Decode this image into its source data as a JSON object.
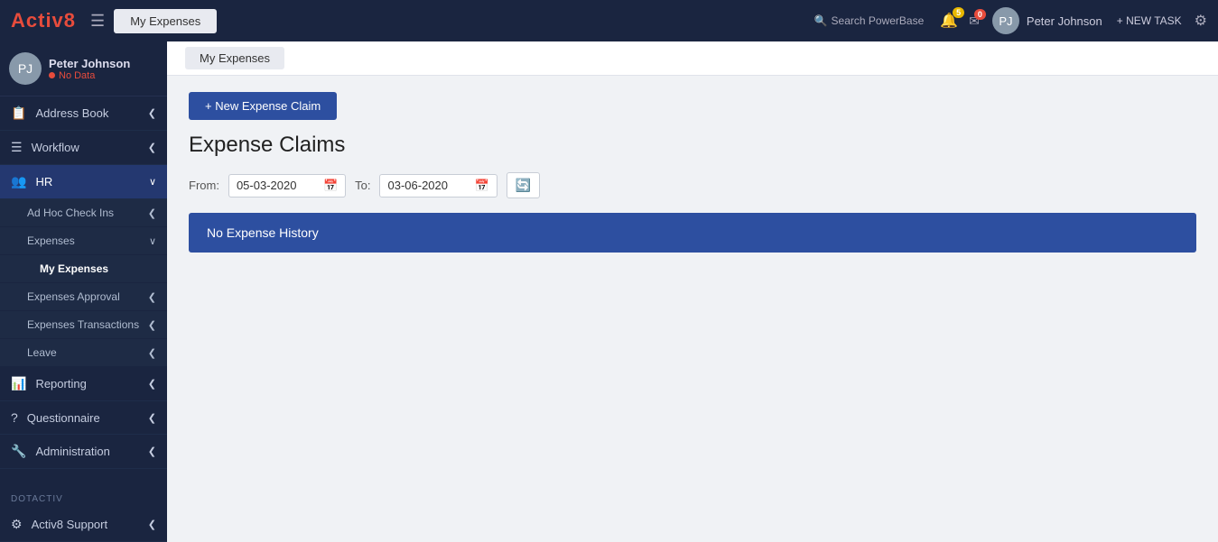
{
  "app": {
    "logo_text": "Activ",
    "logo_accent": "8"
  },
  "topnav": {
    "hamburger_icon": "☰",
    "tab_label": "My Expenses",
    "search_label": "Search PowerBase",
    "notifications_count": "5",
    "messages_count": "0",
    "username": "Peter Johnson",
    "new_task_label": "+ NEW TASK",
    "gear_icon": "⚙"
  },
  "sidebar": {
    "user": {
      "name": "Peter Johnson",
      "status": "No Data"
    },
    "items": [
      {
        "id": "address-book",
        "icon": "📋",
        "label": "Address Book",
        "has_chevron": true
      },
      {
        "id": "workflow",
        "icon": "≡",
        "label": "Workflow",
        "has_chevron": true
      },
      {
        "id": "hr",
        "icon": "👥",
        "label": "HR",
        "has_chevron": true,
        "active": true
      },
      {
        "id": "ad-hoc",
        "icon": "",
        "label": "Ad Hoc Check Ins",
        "has_chevron": true,
        "sub": true
      },
      {
        "id": "expenses",
        "icon": "",
        "label": "Expenses",
        "has_chevron": true,
        "sub": true
      },
      {
        "id": "my-expenses",
        "icon": "",
        "label": "My Expenses",
        "active_page": true,
        "sub2": true
      },
      {
        "id": "expenses-approval",
        "icon": "",
        "label": "Expenses Approval",
        "has_chevron": true,
        "sub": true
      },
      {
        "id": "expenses-transactions",
        "icon": "",
        "label": "Expenses Transactions",
        "has_chevron": true,
        "sub": true
      },
      {
        "id": "leave",
        "icon": "📅",
        "label": "Leave",
        "has_chevron": true,
        "sub": true
      },
      {
        "id": "reporting",
        "icon": "📊",
        "label": "Reporting",
        "has_chevron": true
      },
      {
        "id": "questionnaire",
        "icon": "?",
        "label": "Questionnaire",
        "has_chevron": true
      },
      {
        "id": "administration",
        "icon": "🔧",
        "label": "Administration",
        "has_chevron": true
      }
    ],
    "section_label": "DOTACTIV",
    "activ8_support": {
      "label": "Activ8 Support",
      "has_chevron": true
    }
  },
  "main": {
    "breadcrumb_tab": "My Expenses",
    "new_expense_btn": "+ New Expense Claim",
    "page_title": "Expense Claims",
    "from_label": "From:",
    "to_label": "To:",
    "from_date": "05-03-2020",
    "to_date": "03-06-2020",
    "no_expense_text": "No Expense History"
  }
}
